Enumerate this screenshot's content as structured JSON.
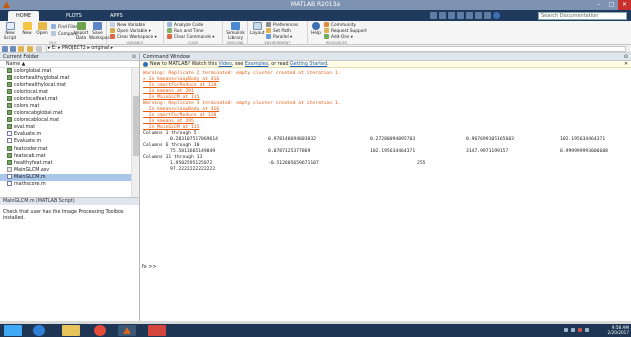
{
  "window": {
    "title": "MATLAB R2013a",
    "controls": [
      "–",
      "□",
      "✕"
    ]
  },
  "tabs": [
    "HOME",
    "PLOTS",
    "APPS"
  ],
  "search": {
    "placeholder": "Search Documentation"
  },
  "ribbon": {
    "groups": [
      "FILE",
      "VARIABLE",
      "CODE",
      "SIMULINK",
      "ENVIRONMENT",
      "RESOURCES"
    ],
    "new_script": "New\nScript",
    "new": "New",
    "open": "Open",
    "find_files": "Find Files",
    "compare": "Compare",
    "import_data": "Import\nData",
    "save_workspace": "Save\nWorkspace",
    "new_variable": "New Variable",
    "open_variable": "Open Variable ▾",
    "clear_workspace": "Clear Workspace ▾",
    "analyze_code": "Analyze Code",
    "run_and_time": "Run and Time",
    "clear_commands": "Clear Commands ▾",
    "simulink_library": "Simulink\nLibrary",
    "layout": "Layout",
    "preferences": "Preferences",
    "set_path": "Set Path",
    "parallel": "Parallel ▾",
    "help": "Help",
    "community": "Community",
    "request_support": "Request Support",
    "add_ons": "Add-Ons ▾"
  },
  "address": {
    "crumbs": "▸ E: ▸ PROJECT2 ▸ original ▸"
  },
  "current_folder": {
    "title": "Current Folder",
    "column": "Name ▲",
    "files": [
      {
        "name": "colorglobal.mat",
        "type": "mat"
      },
      {
        "name": "colorhealthyglobal.mat",
        "type": "mat"
      },
      {
        "name": "colorhealthylocal.mat",
        "type": "mat"
      },
      {
        "name": "colorlocal.mat",
        "type": "mat"
      },
      {
        "name": "colorlocalfeat.mat",
        "type": "mat"
      },
      {
        "name": "colors.mat",
        "type": "mat"
      },
      {
        "name": "colorscabglobal.mat",
        "type": "mat"
      },
      {
        "name": "colorscablocal.mat",
        "type": "mat"
      },
      {
        "name": "eval.mat",
        "type": "mat"
      },
      {
        "name": "Evaluate.m",
        "type": "m"
      },
      {
        "name": "Evaluate.m",
        "type": "m"
      },
      {
        "name": "featcoder.mat",
        "type": "mat"
      },
      {
        "name": "featscab.mat",
        "type": "mat"
      },
      {
        "name": "healthyfeat.mat",
        "type": "mat"
      },
      {
        "name": "MainGLCM.asv",
        "type": "asv"
      },
      {
        "name": "MainGLCM.m",
        "type": "m"
      },
      {
        "name": "mathscore.m",
        "type": "m"
      }
    ],
    "details_title": "MainGLCM.m (MATLAB Script)",
    "details_text": "Check that user has the Image Processing Toolbox installed."
  },
  "command_window": {
    "title": "Command Window",
    "notice_pre": "New to MATLAB? Watch this ",
    "notice_video": "Video",
    "notice_mid": ", see ",
    "notice_examples": "Examples",
    "notice_mid2": ", or read ",
    "notice_gs": "Getting Started",
    "notice_end": ".",
    "warn1": "Warning: Replicate 2 terminated: empty cluster created at iteration 1.",
    "warn1_lines": [
      "> In kmeans>loopBody at 416",
      "  In smartForReduce at 128",
      "  In kmeans at 291",
      "  In MainGLCM at 115"
    ],
    "warn2": "Warning: Replicate 3 terminated: empty cluster created at iteration 1.",
    "warn2_lines": [
      "  In kmeans>loopBody at 416",
      "  In smartForReduce at 128",
      "  In kmeans at 295",
      "  In MainGLCM at 115"
    ],
    "col1_header": "Columns 1 through 5",
    "col1_values": [
      "0.203107517869614",
      "0.978148694803832",
      "0.27280094095783",
      "0.967699105165603",
      "102.195634464371"
    ],
    "col2_header": "Columns 6 through 10",
    "col2_values": [
      "75.5813665149849",
      "0.0787125377869",
      "102.195634464371",
      "3147.9971199157",
      "0.999999993006608"
    ],
    "col3_header": "Columns 11 through 13",
    "col3_values": [
      "1.9502595125072",
      "-0.512605659671187",
      "255"
    ],
    "col3_value2": "97.2222222222222",
    "prompt": "fx >>"
  },
  "taskbar": {
    "time": "9:58 AM",
    "date": "2/20/2017"
  }
}
